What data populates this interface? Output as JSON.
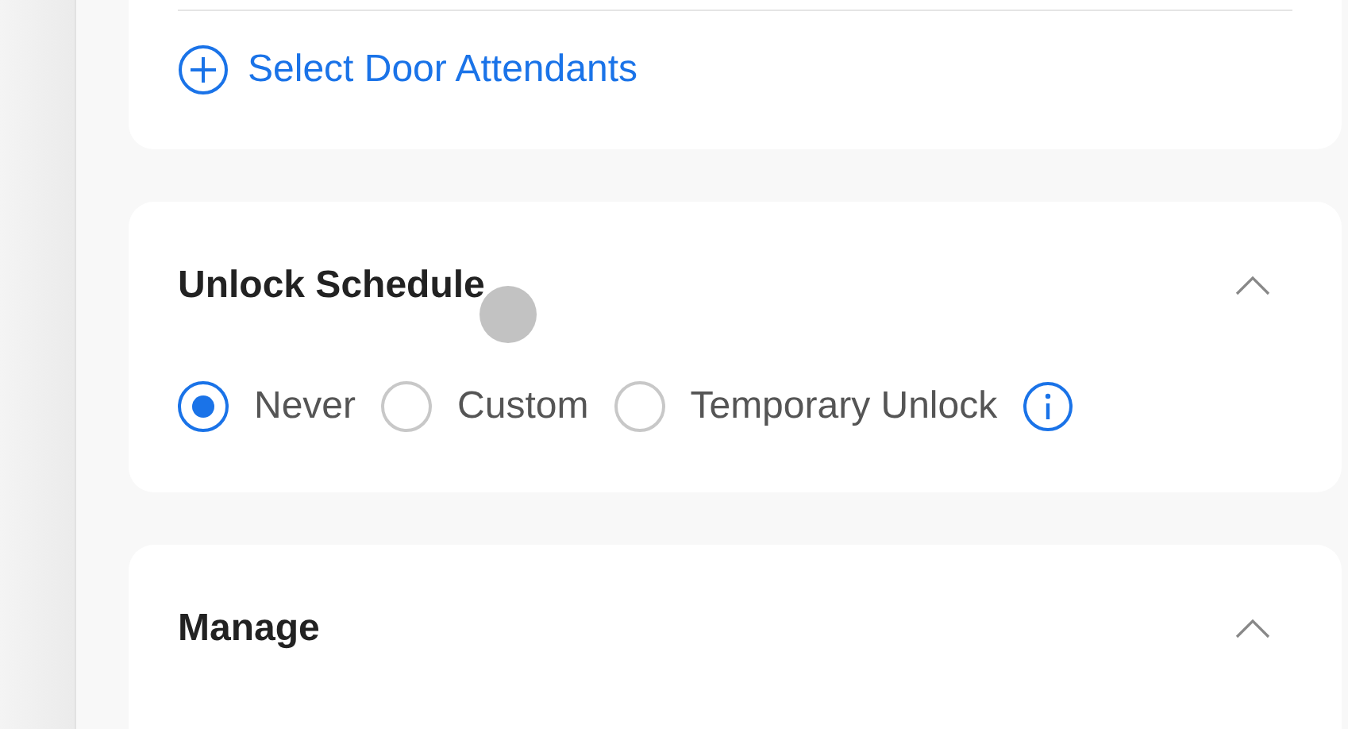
{
  "attendants_card": {
    "add_link": "Select Door Attendants"
  },
  "sections": [
    {
      "title": "Unlock Schedule",
      "expanded": true,
      "options": [
        {
          "label": "Never",
          "selected": true
        },
        {
          "label": "Custom",
          "selected": false
        },
        {
          "label": "Temporary Unlock",
          "selected": false
        }
      ]
    },
    {
      "title": "Manage",
      "expanded": true
    }
  ]
}
